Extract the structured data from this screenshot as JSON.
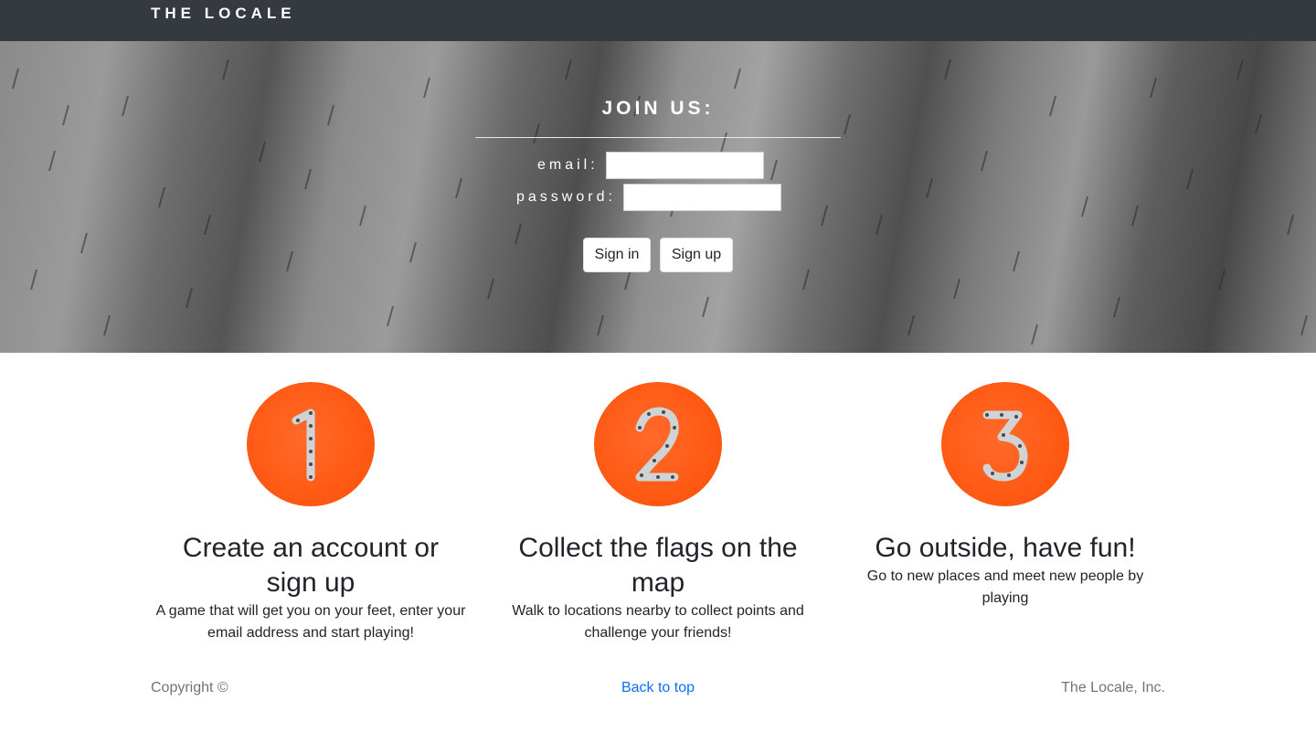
{
  "navbar": {
    "brand": "THE LOCALE"
  },
  "hero": {
    "title": "JOIN US:",
    "email_label": "email:",
    "password_label": "password:",
    "email_value": "",
    "password_value": "",
    "signin_label": "Sign in",
    "signup_label": "Sign up"
  },
  "features": [
    {
      "number": "1",
      "title": "Create an account or sign up",
      "text": "A game that will get you on your feet, enter your email address and start playing!"
    },
    {
      "number": "2",
      "title": "Collect the flags on the map",
      "text": "Walk to locations nearby to collect points and challenge your friends!"
    },
    {
      "number": "3",
      "title": "Go outside, have fun!",
      "text": "Go to new places and meet new people by playing"
    }
  ],
  "footer": {
    "copyright": "Copyright ©",
    "back_to_top": "Back to top",
    "company": "The Locale, Inc."
  },
  "colors": {
    "navbar_bg": "#343a40",
    "badge_orange": "#ff5a14",
    "link_blue": "#0d6efd",
    "muted_gray": "#6c757d"
  }
}
